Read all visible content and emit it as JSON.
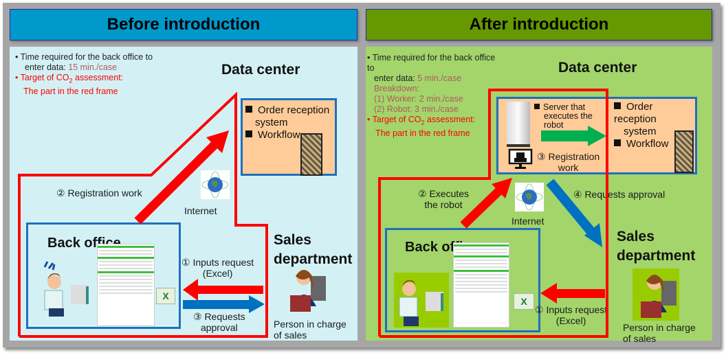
{
  "before": {
    "title": "Before introduction",
    "note": {
      "time_prefix": "• Time required for the back office to",
      "time_line2": "enter data: ",
      "time_value": "15 min./case",
      "target_line1": "• Target of CO",
      "target_sub": "2",
      "target_line1_suffix": " assessment:",
      "target_line2": "The part in the red frame"
    },
    "data_center": "Data center",
    "dc_items": [
      "Order reception",
      "system",
      "Workflow"
    ],
    "registration": "② Registration work",
    "internet": "Internet",
    "back_office": "Back office",
    "sales_line1": "Sales",
    "sales_line2": "department",
    "inputs_request_1": "① Inputs request",
    "inputs_request_2": "(Excel)",
    "requests_approval_1": "③ Requests",
    "requests_approval_2": "approval",
    "person_1": "Person in charge",
    "person_2": "of sales"
  },
  "after": {
    "title": "After introduction",
    "note": {
      "time_prefix": "• Time required for the back office to",
      "time_line2": "enter data: ",
      "time_value": "5 min./case",
      "breakdown": "Breakdown:",
      "worker": "(1) Worker: 2 min./case",
      "robot": "(2) Robot: 3 min./case",
      "target_line1": "• Target of CO",
      "target_sub": "2",
      "target_line1_suffix": " assessment:",
      "target_line2": "The part in the red frame"
    },
    "data_center": "Data center",
    "server_items": [
      "Server that",
      "executes the",
      "robot"
    ],
    "dc_items": [
      "Order reception",
      "system",
      "Workflow"
    ],
    "registration_1": "③ Registration",
    "registration_2": "work",
    "executes_1": "② Executes",
    "executes_2": "the robot",
    "internet": "Internet",
    "requests_approval": "④ Requests approval",
    "back_office": "Back office",
    "sales_line1": "Sales",
    "sales_line2": "department",
    "inputs_request_1": "① Inputs request",
    "inputs_request_2": "(Excel)",
    "person_1": "Person in charge",
    "person_2": "of sales"
  },
  "colors": {
    "before_header": "#0099cc",
    "after_header": "#669900",
    "before_bg": "#d3f1f5",
    "after_bg": "#a3d56b",
    "red_frame": "#ff0000",
    "blue_arrow": "#0070c0",
    "green_arrow": "#00b050",
    "data_center_fill": "#ffcc99"
  }
}
